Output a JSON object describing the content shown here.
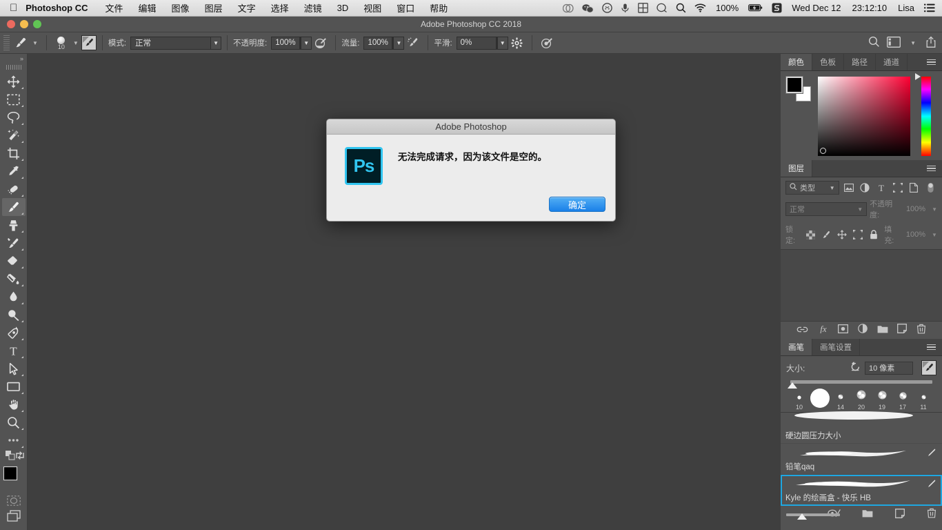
{
  "macbar": {
    "apple_icon": "apple-icon",
    "app_name": "Photoshop CC",
    "menus": [
      "文件",
      "编辑",
      "图像",
      "图层",
      "文字",
      "选择",
      "滤镜",
      "3D",
      "视图",
      "窗口",
      "帮助"
    ],
    "status_icons": [
      "creative-cloud-icon",
      "wechat-icon",
      "qq-icon",
      "mic-icon",
      "input-method-icon",
      "search-circle-icon",
      "spotlight-icon",
      "wifi-icon"
    ],
    "battery_percent": "100%",
    "battery_icon": "battery-charging-icon",
    "sogou_icon": "sogou-icon",
    "date": "Wed Dec 12",
    "time": "23:12:10",
    "user": "Lisa",
    "notification_icon": "notification-center-icon"
  },
  "window": {
    "title": "Adobe Photoshop CC 2018",
    "controls": [
      "close",
      "minimize",
      "zoom"
    ]
  },
  "options_bar": {
    "tool_icon": "brush-tool-icon",
    "brush_preset_size": "10",
    "airbrush_toggle_icon": "brush-settings-toggle-icon",
    "mode_label": "模式:",
    "mode_value": "正常",
    "opacity_label": "不透明度:",
    "opacity_value": "100%",
    "opacity_pressure_icon": "pressure-opacity-icon",
    "flow_label": "流量:",
    "flow_value": "100%",
    "airbrush_icon": "airbrush-icon",
    "smoothing_label": "平滑:",
    "smoothing_value": "0%",
    "gear_icon": "gear-icon",
    "pressure_size_icon": "pressure-size-icon",
    "right_icons": [
      "search-icon",
      "workspace-icon",
      "chevron-down-icon",
      "share-icon"
    ]
  },
  "tools": [
    {
      "name": "move-tool",
      "icon": "move-icon",
      "active": false
    },
    {
      "name": "marquee-tool",
      "icon": "rect-marquee-icon",
      "active": false
    },
    {
      "name": "lasso-tool",
      "icon": "lasso-icon",
      "active": false
    },
    {
      "name": "magic-wand-tool",
      "icon": "magic-wand-icon",
      "active": false
    },
    {
      "name": "crop-tool",
      "icon": "crop-icon",
      "active": false
    },
    {
      "name": "eyedropper-tool",
      "icon": "eyedropper-icon",
      "active": false
    },
    {
      "name": "healing-brush-tool",
      "icon": "healing-brush-icon",
      "active": false
    },
    {
      "name": "brush-tool",
      "icon": "brush-icon",
      "active": true
    },
    {
      "name": "clone-stamp-tool",
      "icon": "clone-stamp-icon",
      "active": false
    },
    {
      "name": "history-brush-tool",
      "icon": "history-brush-icon",
      "active": false
    },
    {
      "name": "eraser-tool",
      "icon": "eraser-icon",
      "active": false
    },
    {
      "name": "gradient-tool",
      "icon": "gradient-bucket-icon",
      "active": false
    },
    {
      "name": "blur-tool",
      "icon": "blur-drop-icon",
      "active": false
    },
    {
      "name": "dodge-tool",
      "icon": "dodge-icon",
      "active": false
    },
    {
      "name": "pen-tool",
      "icon": "pen-icon",
      "active": false
    },
    {
      "name": "type-tool",
      "icon": "type-icon",
      "active": false
    },
    {
      "name": "path-selection-tool",
      "icon": "path-arrow-icon",
      "active": false
    },
    {
      "name": "rectangle-tool",
      "icon": "rectangle-icon",
      "active": false
    },
    {
      "name": "hand-tool",
      "icon": "hand-icon",
      "active": false
    },
    {
      "name": "zoom-tool",
      "icon": "zoom-magnifier-icon",
      "active": false
    },
    {
      "name": "more-tools",
      "icon": "ellipsis-icon",
      "active": false
    }
  ],
  "tool_footer": {
    "default_colors_icon": "default-colors-icon",
    "swap_colors_icon": "swap-colors-icon",
    "foreground_color": "#000000",
    "background_color": "#ffffff",
    "quick_mask_icon": "quick-mask-icon",
    "screen_mode_icon": "screen-mode-icon"
  },
  "color_panel": {
    "tabs": [
      "颜色",
      "色板",
      "路径",
      "通道"
    ],
    "active_tab": "颜色",
    "menu_icon": "panel-menu-icon",
    "foreground": "#000000",
    "background": "#ffffff"
  },
  "layers_panel": {
    "tabs": [
      "图层"
    ],
    "active_tab": "图层",
    "menu_icon": "panel-menu-icon",
    "filter_label": "类型",
    "filter_icon": "search-icon",
    "filter_kind_icons": [
      "pixel-filter-icon",
      "adjustment-filter-icon",
      "type-filter-icon",
      "shape-filter-icon",
      "smart-object-filter-icon"
    ],
    "filter_toggle_icon": "filter-toggle-icon",
    "blend_mode": "正常",
    "opacity_label": "不透明度:",
    "opacity_value": "100%",
    "lock_label": "锁定:",
    "lock_icons": [
      "lock-transparency-icon",
      "lock-image-icon",
      "lock-position-icon",
      "lock-artboard-icon",
      "lock-all-icon"
    ],
    "fill_label": "填充:",
    "fill_value": "100%",
    "footer_icons": [
      "link-layers-icon",
      "fx-icon",
      "add-mask-icon",
      "adjustment-layer-icon",
      "new-group-icon",
      "new-layer-icon",
      "delete-layer-icon"
    ]
  },
  "brush_panel": {
    "tabs": [
      "画笔",
      "画笔设置"
    ],
    "active_tab": "画笔",
    "menu_icon": "panel-menu-icon",
    "size_label": "大小:",
    "reset_icon": "reset-size-icon",
    "size_value": "10 像素",
    "toggle_icon": "brush-toggle-icon",
    "size_presets": [
      "10",
      "",
      "14",
      "20",
      "19",
      "17",
      "11"
    ],
    "brushes": [
      {
        "name": "硬边圆压力大小",
        "selected": false
      },
      {
        "name": "铅笔qaq",
        "selected": false
      },
      {
        "name": "Kyle 的绘画盒 - 快乐 HB",
        "selected": true
      }
    ],
    "footer_icons": [
      "brush-size-slider",
      "toggle-visibility-icon",
      "new-group-icon",
      "new-brush-icon",
      "delete-brush-icon"
    ],
    "selection_color": "#1ea7e1"
  },
  "dialog": {
    "title": "Adobe Photoshop",
    "logo_text": "Ps",
    "logo_border_color": "#31c5f0",
    "logo_bg_color": "#001e26",
    "message": "无法完成请求，因为该文件是空的。",
    "ok_label": "确定",
    "ok_color": "#1a80e8"
  }
}
